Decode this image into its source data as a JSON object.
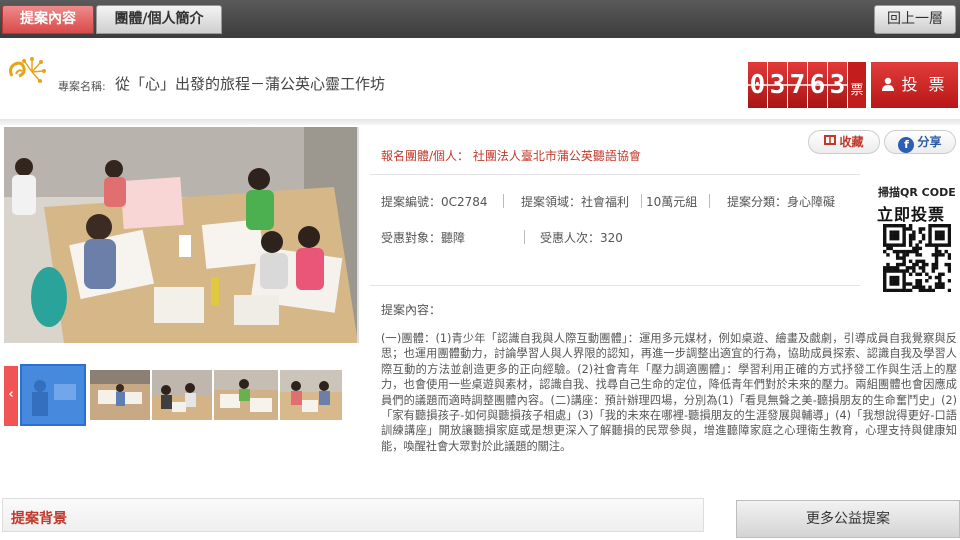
{
  "nav": {
    "tabs": [
      {
        "label": "提案內容",
        "active": true
      },
      {
        "label": "團體/個人簡介",
        "active": false
      }
    ],
    "back_label": "回上一層"
  },
  "header": {
    "project_prefix": "專案名稱:",
    "project_name": "從「心」出發的旅程－蒲公英心靈工作坊",
    "vote_count_digits": [
      "0",
      "3",
      "7",
      "6",
      "3"
    ],
    "vote_unit": "票",
    "vote_button": "投 票"
  },
  "thumbnails": {
    "prev_label": "‹",
    "count": 5,
    "selected_index": 0
  },
  "info": {
    "organizer_label": "報名團體/個人：",
    "organizer": "社團法人臺北市蒲公英聽語協會",
    "favorite_label": "收藏",
    "share_label": "分享",
    "case_no_label": "提案編號：",
    "case_no": "0C2784",
    "domain_label": "提案領域：",
    "domain": "社會福利",
    "group": "10萬元組",
    "category_label": "提案分類：",
    "category": "身心障礙",
    "beneficiary_label": "受惠對象：",
    "beneficiary": "聽障",
    "beneficiary_count_label": "受惠人次：",
    "beneficiary_count": "320",
    "qr_caption_1": "掃描QR CODE",
    "qr_caption_2": "立即投票",
    "content_label": "提案內容：",
    "content_text": "(一)團體：(1)青少年「認識自我與人際互動團體」：運用多元媒材，例如桌遊、繪畫及戲劇，引導成員自我覺察與反思；也運用團體動力，討論學習人與人界限的認知，再進一步調整出適宜的行為，協助成員探索、認識自我及學習人際互動的方法並創造更多的正向經驗。(2)社會青年「壓力調適團體」：學習利用正確的方式抒發工作與生活上的壓力，也會使用一些桌遊與素材，認識自我、找尋自己生命的定位，降低青年們對於未來的壓力。兩組團體也會因應成員們的議題而適時調整團體內容。(二)講座：預計辦理四場，分別為(1)「看見無聲之美-聽損朋友的生命奮鬥史」(2)「家有聽損孩子-如何與聽損孩子相處」(3)「我的未來在哪裡-聽損朋友的生涯發展與輔導」(4)「我想說得更好-口語訓練講座」開放讓聽損家庭或是想更深入了解聽損的民眾參與，增進聽障家庭之心理衛生教育，心理支持與健康知能，喚醒社會大眾對於此議題的關注。"
  },
  "bottom": {
    "section_title": "提案背景",
    "more_button": "更多公益提案"
  },
  "colors": {
    "accent_red": "#c0392b",
    "vote_red": "#d42a2a",
    "thumb_selected": "#3a86e6"
  }
}
